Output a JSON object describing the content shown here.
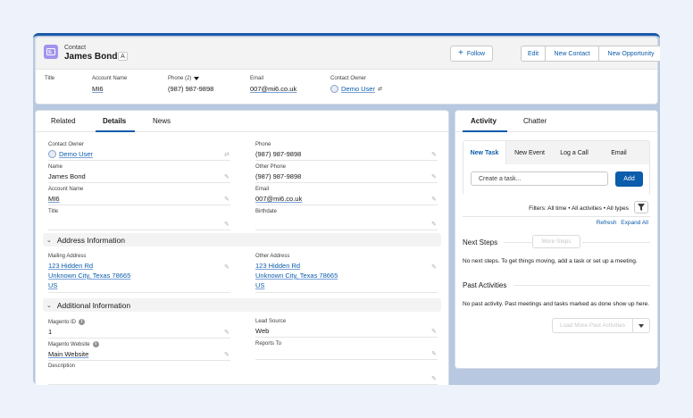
{
  "record": {
    "object_label": "Contact",
    "name": "James Bond",
    "follow_glyph": "A"
  },
  "actions": {
    "follow": "Follow",
    "edit": "Edit",
    "new_contact": "New Contact",
    "new_opportunity": "New Opportunity"
  },
  "highlights": {
    "title": {
      "label": "Title",
      "value": ""
    },
    "account": {
      "label": "Account Name",
      "value": "MI6"
    },
    "phone": {
      "label": "Phone (2)",
      "value": "(987) 987-9898"
    },
    "email": {
      "label": "Email",
      "value": "007@mi6.co.uk"
    },
    "owner": {
      "label": "Contact Owner",
      "value": "Demo User"
    }
  },
  "detail_tabs": [
    "Related",
    "Details",
    "News"
  ],
  "active_detail_tab": "Details",
  "details": {
    "contact_owner": {
      "label": "Contact Owner",
      "value": "Demo User"
    },
    "phone": {
      "label": "Phone",
      "value": "(987) 987-9898"
    },
    "name": {
      "label": "Name",
      "value": "James Bond"
    },
    "other_phone": {
      "label": "Other Phone",
      "value": "(987) 987-9898"
    },
    "account_name": {
      "label": "Account Name",
      "value": "MI6"
    },
    "email": {
      "label": "Email",
      "value": "007@mi6.co.uk"
    },
    "title": {
      "label": "Title",
      "value": ""
    },
    "birthdate": {
      "label": "Birthdate",
      "value": ""
    }
  },
  "address_section": {
    "title": "Address Information",
    "mailing": {
      "label": "Mailing Address",
      "line1": "123 Hidden Rd",
      "line2": "Unknown City, Texas 78665",
      "line3": "US"
    },
    "other": {
      "label": "Other Address",
      "line1": "123 Hidden Rd",
      "line2": "Unknown City, Texas 78665",
      "line3": "US"
    }
  },
  "additional_section": {
    "title": "Additional Information",
    "magento_id": {
      "label": "Magento ID",
      "value": "1"
    },
    "lead_source": {
      "label": "Lead Source",
      "value": "Web"
    },
    "magento_website": {
      "label": "Magento Website",
      "value": "Main Website"
    },
    "reports_to": {
      "label": "Reports To",
      "value": ""
    },
    "description": {
      "label": "Description",
      "value": ""
    }
  },
  "activity": {
    "tabs": [
      "Activity",
      "Chatter"
    ],
    "composer_tabs": [
      "New Task",
      "New Event",
      "Log a Call",
      "Email"
    ],
    "task_placeholder": "Create a task...",
    "add_label": "Add",
    "filters": "Filters: All time • All activities • All types",
    "refresh": "Refresh",
    "expand_all": "Expand All",
    "next_steps_title": "Next Steps",
    "more_steps": "More Steps",
    "next_steps_empty": "No next steps. To get things moving, add a task or set up a meeting.",
    "past_title": "Past Activities",
    "past_empty": "No past activity. Past meetings and tasks marked as done show up here.",
    "load_more": "Load More Past Activities"
  },
  "colors": {
    "brand": "#0b5cab",
    "contact_icon": "#a094ed"
  },
  "icons": [
    "contact-icon",
    "follow-plus-icon",
    "chevron-down-icon",
    "pencil-icon",
    "info-icon",
    "user-avatar-icon",
    "filter-icon",
    "change-owner-icon"
  ]
}
